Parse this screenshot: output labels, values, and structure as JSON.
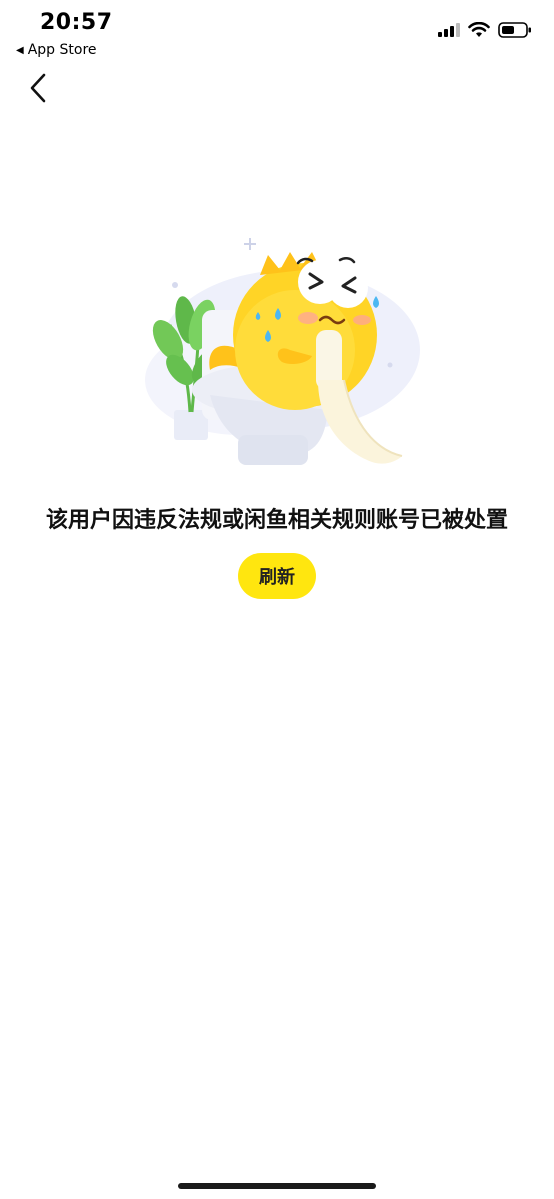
{
  "status_bar": {
    "time": "20:57",
    "back_app_label": "App Store",
    "icons": [
      "signal-icon",
      "wifi-icon",
      "battery-icon"
    ]
  },
  "nav": {
    "back_icon": "chevron-left-icon"
  },
  "illustration": {
    "icon": "fish-mascot-on-toilet-illustration"
  },
  "message": "该用户因违反法规或闲鱼相关规则账号已被处置",
  "refresh_label": "刷新",
  "colors": {
    "accent": "#ffe60f",
    "text": "#111111",
    "background": "#ffffff"
  }
}
